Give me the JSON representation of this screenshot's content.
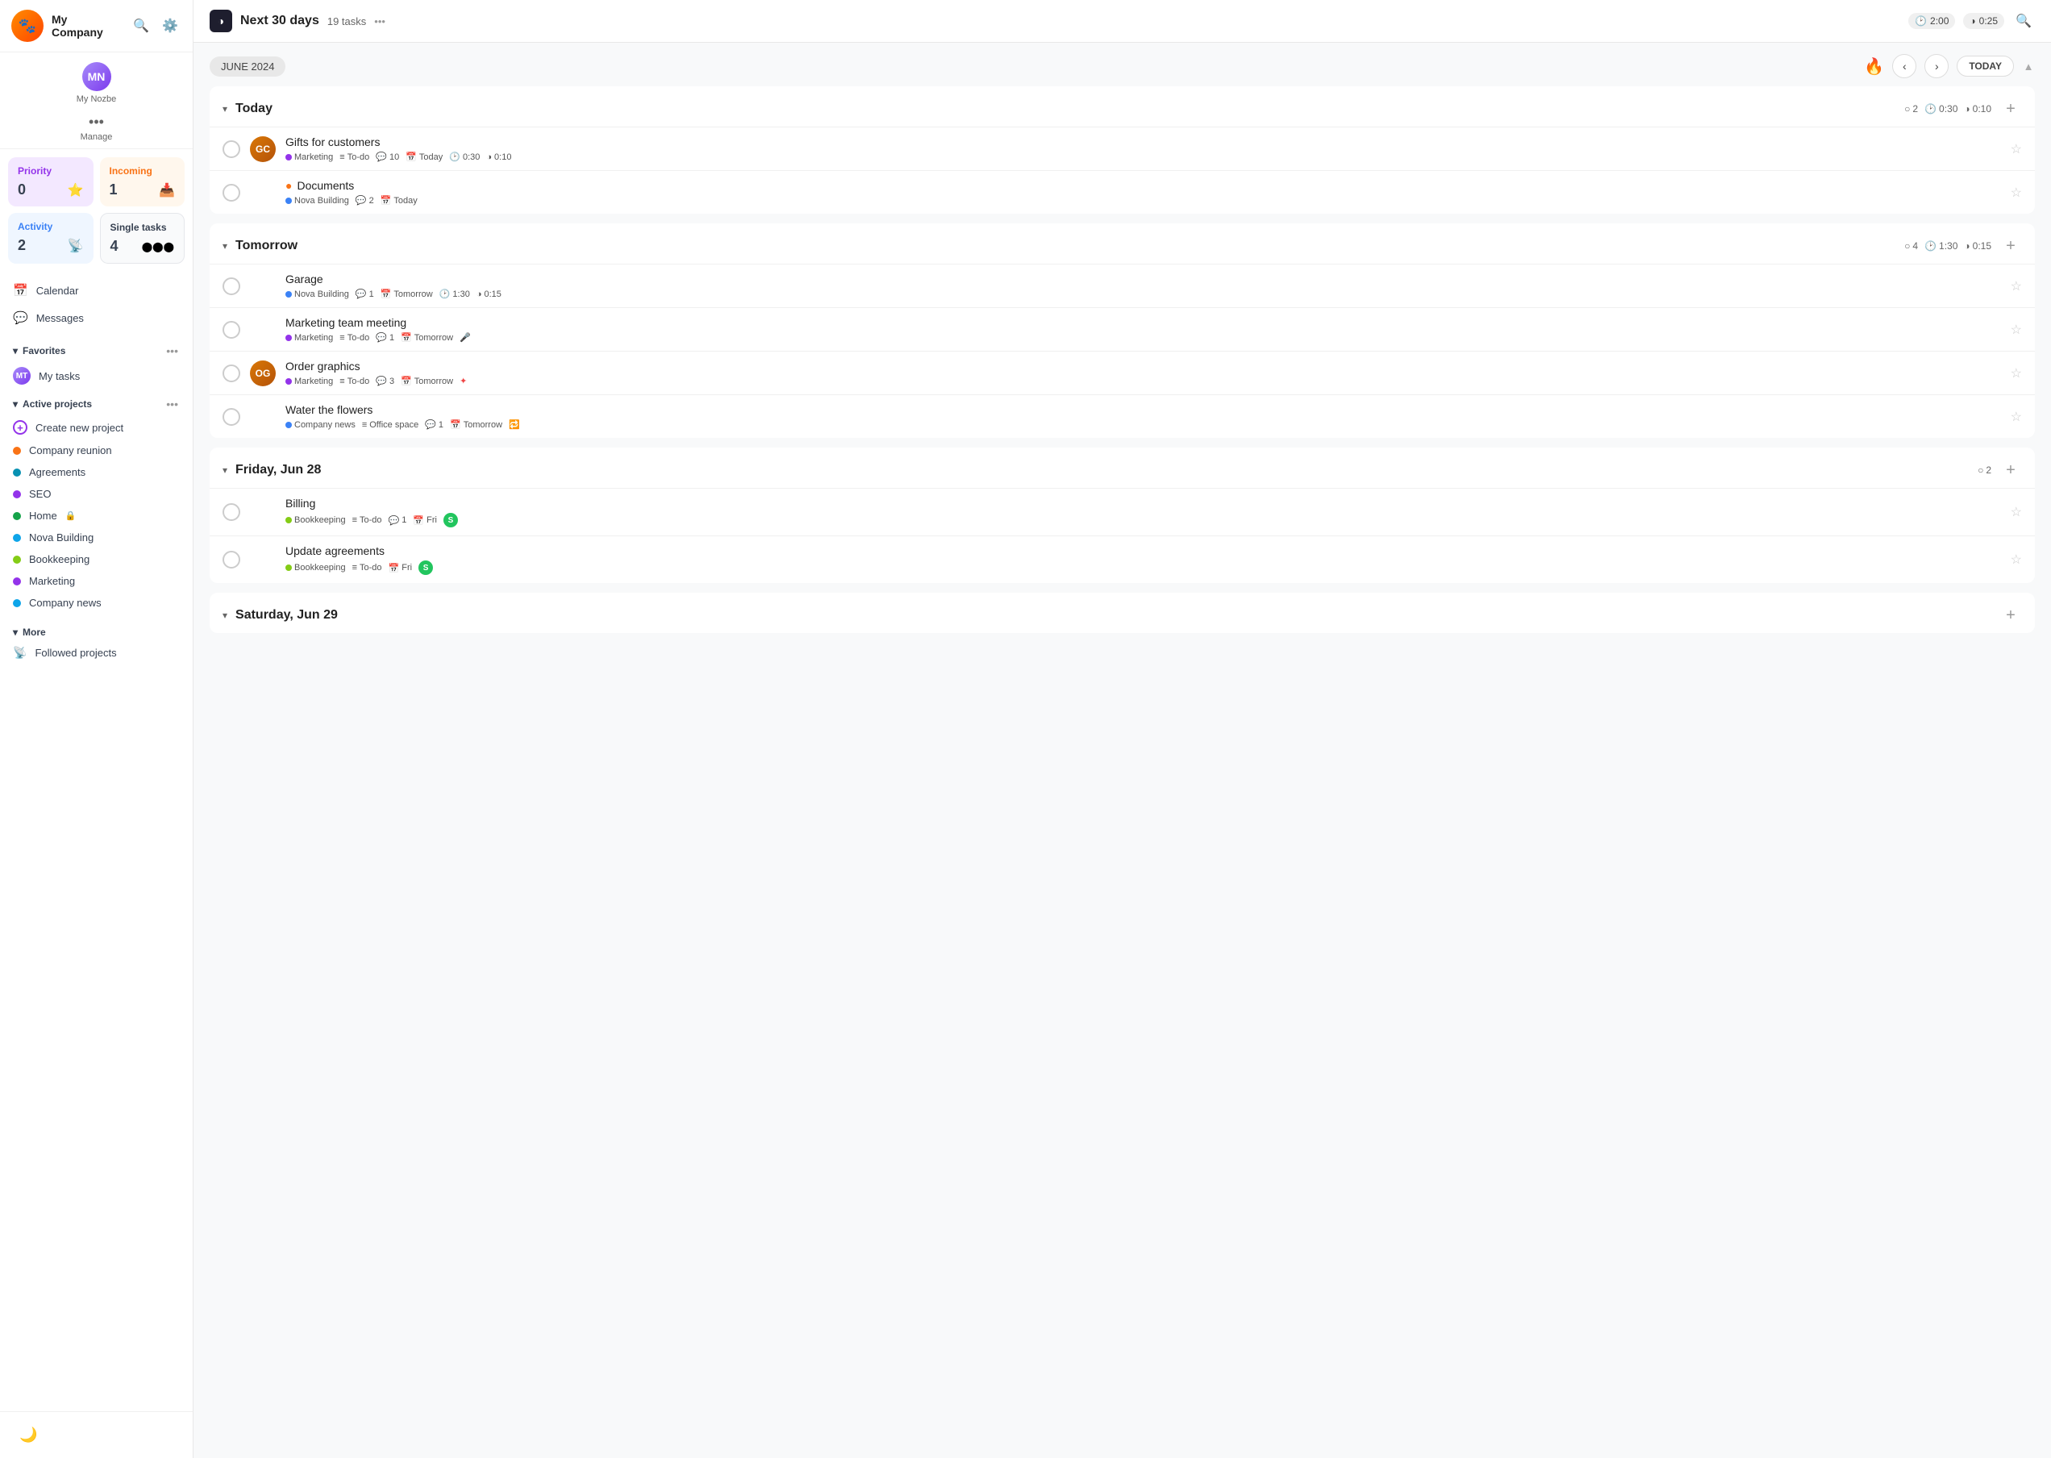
{
  "sidebar": {
    "company_name": "My Company",
    "user_name": "My Nozbe",
    "manage_label": "Manage",
    "stats": [
      {
        "id": "priority",
        "title": "Priority",
        "value": "0",
        "icon": "⭐",
        "type": "priority"
      },
      {
        "id": "incoming",
        "title": "Incoming",
        "value": "1",
        "icon": "📥",
        "type": "incoming"
      },
      {
        "id": "activity",
        "title": "Activity",
        "value": "2",
        "icon": "📡",
        "type": "activity"
      },
      {
        "id": "single",
        "title": "Single tasks",
        "value": "4",
        "icon": "⬤⬤⬤",
        "type": "single"
      }
    ],
    "nav": [
      {
        "id": "calendar",
        "icon": "📅",
        "label": "Calendar"
      },
      {
        "id": "messages",
        "icon": "💬",
        "label": "Messages"
      }
    ],
    "favorites_label": "Favorites",
    "my_tasks_label": "My tasks",
    "active_projects_label": "Active projects",
    "projects": [
      {
        "id": "new",
        "label": "Create new project",
        "color": "#9333ea",
        "is_create": true
      },
      {
        "id": "reunion",
        "label": "Company reunion",
        "color": "#f97316"
      },
      {
        "id": "agreements",
        "label": "Agreements",
        "color": "#0891b2"
      },
      {
        "id": "seo",
        "label": "SEO",
        "color": "#9333ea"
      },
      {
        "id": "home",
        "label": "Home",
        "color": "#16a34a",
        "locked": true
      },
      {
        "id": "nova",
        "label": "Nova Building",
        "color": "#0ea5e9"
      },
      {
        "id": "bookkeeping",
        "label": "Bookkeeping",
        "color": "#84cc16"
      },
      {
        "id": "marketing",
        "label": "Marketing",
        "color": "#9333ea"
      },
      {
        "id": "company-news",
        "label": "Company news",
        "color": "#0ea5e9"
      }
    ],
    "more_label": "More",
    "followed_label": "Followed projects"
  },
  "topbar": {
    "icon": "◑",
    "title": "Next 30 days",
    "task_count": "19 tasks",
    "time1_icon": "🕑",
    "time1": "2:00",
    "time2_icon": "◑",
    "time2": "0:25"
  },
  "date_bar": {
    "month_label": "JUNE 2024",
    "today_label": "TODAY"
  },
  "sections": [
    {
      "id": "today",
      "name": "Today",
      "task_count": "2",
      "time1": "0:30",
      "time2": "0:10",
      "tasks": [
        {
          "id": "t1",
          "name": "Gifts for customers",
          "project": "Marketing",
          "project_color": "#9333ea",
          "section": "To-do",
          "comments": "10",
          "date": "Today",
          "time1": "0:30",
          "time2": "0:10",
          "has_avatar": true,
          "avatar_bg": "#d97706"
        },
        {
          "id": "t2",
          "name": "Documents",
          "project": "Nova Building",
          "project_color": "#0ea5e9",
          "comments": "2",
          "date": "Today",
          "has_priority_icon": true
        }
      ]
    },
    {
      "id": "tomorrow",
      "name": "Tomorrow",
      "task_count": "4",
      "time1": "1:30",
      "time2": "0:15",
      "tasks": [
        {
          "id": "t3",
          "name": "Garage",
          "project": "Nova Building",
          "project_color": "#0ea5e9",
          "comments": "1",
          "date": "Tomorrow",
          "time1": "1:30",
          "time2": "0:15"
        },
        {
          "id": "t4",
          "name": "Marketing team meeting",
          "project": "Marketing",
          "project_color": "#9333ea",
          "section": "To-do",
          "comments": "1",
          "date": "Tomorrow",
          "has_mic": true
        },
        {
          "id": "t5",
          "name": "Order graphics",
          "project": "Marketing",
          "project_color": "#9333ea",
          "section": "To-do",
          "comments": "3",
          "date": "Tomorrow",
          "has_star_red": true,
          "has_avatar": true,
          "avatar_bg": "#d97706"
        },
        {
          "id": "t6",
          "name": "Water the flowers",
          "project": "Company news",
          "project_color": "#0ea5e9",
          "section": "Office space",
          "comments": "1",
          "date": "Tomorrow",
          "has_repeat": true
        }
      ]
    },
    {
      "id": "fri-jun-28",
      "name": "Friday, Jun 28",
      "task_count": "2",
      "tasks": [
        {
          "id": "t7",
          "name": "Billing",
          "project": "Bookkeeping",
          "project_color": "#84cc16",
          "section": "To-do",
          "comments": "1",
          "date": "Fri",
          "has_badge_s": true
        },
        {
          "id": "t8",
          "name": "Update agreements",
          "project": "Bookkeeping",
          "project_color": "#84cc16",
          "section": "To-do",
          "date": "Fri",
          "has_badge_s": true
        }
      ]
    },
    {
      "id": "sat-jun-29",
      "name": "Saturday, Jun 29",
      "task_count": "",
      "tasks": []
    }
  ]
}
